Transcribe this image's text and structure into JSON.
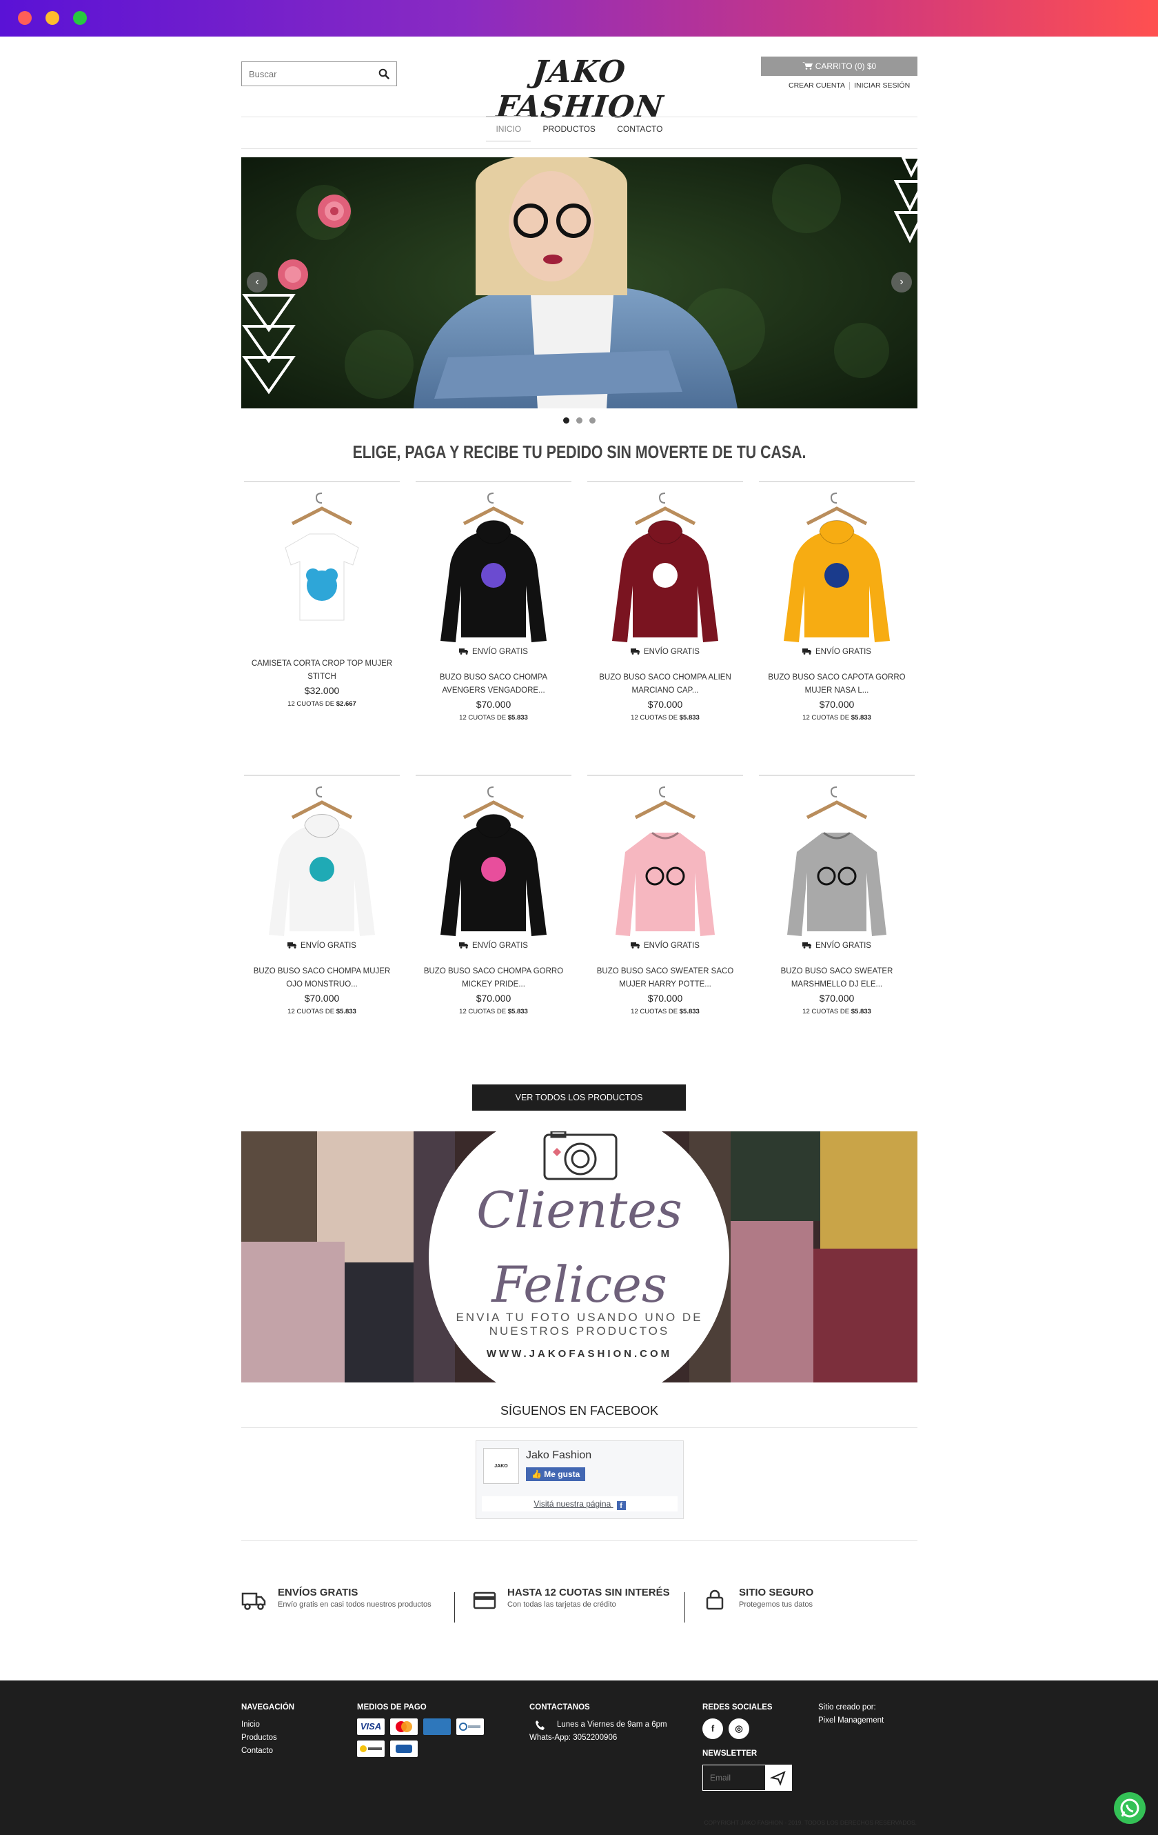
{
  "search": {
    "placeholder": "Buscar"
  },
  "logo": "JAKO FASHION",
  "cart": {
    "label": "CARRITO (0) $0"
  },
  "account": {
    "create": "CREAR CUENTA",
    "login": "INICIAR SESIÓN"
  },
  "nav": [
    "INICIO",
    "PRODUCTOS",
    "CONTACTO"
  ],
  "tagline": "ELIGE, PAGA Y RECIBE TU PEDIDO SIN MOVERTE DE TU CASA.",
  "shipping_label": "ENVÍO GRATIS",
  "products": [
    {
      "title": "CAMISETA CORTA CROP TOP MUJER STITCH",
      "price": "$32.000",
      "cuotas_prefix": "12 CUOTAS DE",
      "cuotas_value": "$2.667",
      "free_shipping": false,
      "color": "#ffffff",
      "kind": "tee",
      "print": "#2ea6d8"
    },
    {
      "title": "BUZO BUSO SACO CHOMPA AVENGERS VENGADORE...",
      "price": "$70.000",
      "cuotas_prefix": "12 CUOTAS DE",
      "cuotas_value": "$5.833",
      "free_shipping": true,
      "color": "#111111",
      "kind": "hoodie",
      "print": "#6b4bd0"
    },
    {
      "title": "BUZO BUSO SACO CHOMPA ALIEN MARCIANO CAP...",
      "price": "$70.000",
      "cuotas_prefix": "12 CUOTAS DE",
      "cuotas_value": "$5.833",
      "free_shipping": true,
      "color": "#7a1420",
      "kind": "hoodie",
      "print": "#ffffff"
    },
    {
      "title": "BUZO BUSO SACO CAPOTA GORRO MUJER NASA L...",
      "price": "$70.000",
      "cuotas_prefix": "12 CUOTAS DE",
      "cuotas_value": "$5.833",
      "free_shipping": true,
      "color": "#f7ac12",
      "kind": "hoodie",
      "print": "#1a3b8c"
    },
    {
      "title": "BUZO BUSO SACO CHOMPA MUJER OJO MONSTRUO...",
      "price": "$70.000",
      "cuotas_prefix": "12 CUOTAS DE",
      "cuotas_value": "$5.833",
      "free_shipping": true,
      "color": "#f4f4f4",
      "kind": "hoodie",
      "print": "#1faab5"
    },
    {
      "title": "BUZO BUSO SACO CHOMPA GORRO MICKEY PRIDE...",
      "price": "$70.000",
      "cuotas_prefix": "12 CUOTAS DE",
      "cuotas_value": "$5.833",
      "free_shipping": true,
      "color": "#111111",
      "kind": "hoodie",
      "print": "#e84e9c"
    },
    {
      "title": "BUZO BUSO SACO SWEATER SACO MUJER HARRY POTTE...",
      "price": "$70.000",
      "cuotas_prefix": "12 CUOTAS DE",
      "cuotas_value": "$5.833",
      "free_shipping": true,
      "color": "#f6b7c0",
      "kind": "sweater",
      "print": "#111111"
    },
    {
      "title": "BUZO BUSO SACO SWEATER MARSHMELLO DJ ELE...",
      "price": "$70.000",
      "cuotas_prefix": "12 CUOTAS DE",
      "cuotas_value": "$5.833",
      "free_shipping": true,
      "color": "#a9a9a9",
      "kind": "sweater",
      "print": "#111111"
    }
  ],
  "view_all": "VER TODOS LOS PRODUCTOS",
  "clientes": {
    "line1": "Clientes",
    "line2": "Felices",
    "sub1": "ENVIA TU FOTO USANDO UNO DE",
    "sub2": "NUESTROS PRODUCTOS",
    "url": "WWW.JAKOFASHION.COM"
  },
  "facebook": {
    "title": "SÍGUENOS EN FACEBOOK",
    "page": "Jako Fashion",
    "like": "Me gusta",
    "visit": "Visitá nuestra página"
  },
  "features": [
    {
      "title": "ENVÍOS GRATIS",
      "sub": "Envío gratis en casi todos nuestros productos"
    },
    {
      "title": "HASTA 12 CUOTAS SIN INTERÉS",
      "sub": "Con todas las tarjetas de crédito"
    },
    {
      "title": "SITIO SEGURO",
      "sub": "Protegemos tus datos"
    }
  ],
  "footer": {
    "nav_title": "NAVEGACIÓN",
    "nav": [
      "Inicio",
      "Productos",
      "Contacto"
    ],
    "pay_title": "MEDIOS DE PAGO",
    "contact_title": "CONTACTANOS",
    "contact": "Lunes a Viernes de 9am a 6pm Whats-App: 3052200906",
    "social_title": "REDES SOCIALES",
    "newsletter_title": "NEWSLETTER",
    "newsletter_placeholder": "Email",
    "credit1": "Sitio creado por:",
    "credit2": "Pixel Management",
    "copyright": "COPYRIGHT JAKO FASHION - 2019. TODOS LOS DERECHOS RESERVADOS."
  },
  "colors": {
    "accent": "#1e1e1e",
    "cart": "#999999",
    "whatsapp": "#34c156"
  }
}
